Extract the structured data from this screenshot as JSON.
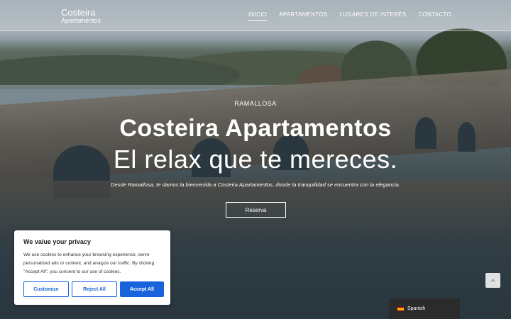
{
  "header": {
    "logo_main": "Costeira",
    "logo_sub": "Apartamentos",
    "nav": [
      {
        "label": "INICIO",
        "active": true
      },
      {
        "label": "APARTAMENTOS",
        "active": false
      },
      {
        "label": "LUGARES DE INTERÉS",
        "active": false
      },
      {
        "label": "CONTACTO",
        "active": false
      }
    ]
  },
  "hero": {
    "eyebrow": "RAMALLOSA",
    "title": "Costeira Apartamentos",
    "subtitle": "El relax que te mereces.",
    "description": "Desde Ramallosa, te damos la bienvenida a Costeira Apartamentos, donde la tranquilidad se encuentra con la elegancia.",
    "button_label": "Reserva"
  },
  "cookie": {
    "title": "We value your privacy",
    "text": "We use cookies to enhance your browsing experience, serve personalized ads or content, and analyze our traffic. By clicking \"Accept All\", you consent to our use of cookies.",
    "customize_label": "Customize",
    "reject_label": "Reject All",
    "accept_label": "Accept All",
    "accent_color": "#1863dc"
  },
  "scroll_top": {
    "icon": "chevron-up-icon"
  },
  "language": {
    "label": "Spanish",
    "flag_icon": "spain-flag-icon"
  }
}
